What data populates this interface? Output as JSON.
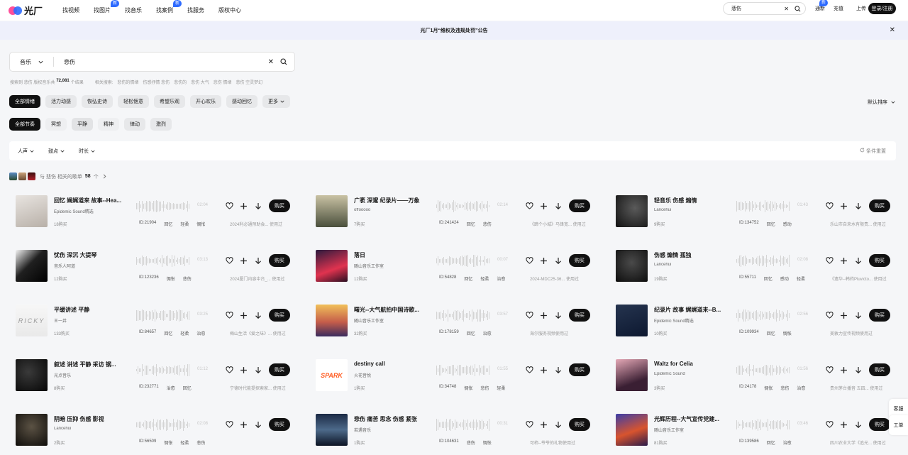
{
  "brand": {
    "name": "光厂"
  },
  "nav": [
    {
      "label": "找视频",
      "badge": ""
    },
    {
      "label": "找图片",
      "badge": "新"
    },
    {
      "label": "找音乐",
      "badge": ""
    },
    {
      "label": "找案例",
      "badge": "新"
    },
    {
      "label": "找服务",
      "badge": ""
    },
    {
      "label": "版权中心",
      "badge": ""
    }
  ],
  "top_search": {
    "value": "悲伤"
  },
  "top_right": {
    "tongxin": "通新",
    "tongxin_badge": "新",
    "recharge": "充值",
    "upload": "上传",
    "login": "登录/注册"
  },
  "notice": {
    "text": "光厂1月“维权及违规处罚”公告"
  },
  "search": {
    "category": "音乐",
    "value": "悲伤"
  },
  "summary": {
    "prefix": "搜索到 悲伤 版权音乐共",
    "count": "72,081",
    "suffix": "个结果",
    "related_label": "相关搜索:",
    "related": [
      "悲伤的情绪",
      "伤感抒情 悲伤",
      "悲伤的",
      "悲伤 大气",
      "悲伤 情绪",
      "悲伤 空灵梦幻"
    ]
  },
  "mood_chips": [
    "全部情绪",
    "活力动感",
    "恢弘史诗",
    "轻松惬意",
    "希望乐观",
    "开心欢乐",
    "感动回忆",
    "更多"
  ],
  "rhythm_chips": [
    "全部节奏",
    "冥想",
    "平静",
    "精神",
    "律动",
    "激烈"
  ],
  "sort_label": "默认排序",
  "filters": {
    "items": [
      "人声",
      "鼓点",
      "时长"
    ],
    "reset": "条件重置"
  },
  "playlists": {
    "prefix": "与 悲伤 相关的歌单",
    "count": "58",
    "suffix": "个"
  },
  "buy_label": "购买",
  "tracks": [
    {
      "title": "回忆 娓娓道来 故事--Hea...",
      "artist": "Epidemic Sound精选",
      "buys": "18购买",
      "duration": "02:04",
      "id": "ID:21904",
      "tags": [
        "回忆",
        "轻柔",
        "惆怅"
      ],
      "use": "2024利必通预助会... 使用过"
    },
    {
      "title": "广袤 深邃 纪录片——万象",
      "artist": "offooooo",
      "buys": "7购买",
      "duration": "02:14",
      "id": "ID:241424",
      "tags": [
        "回忆",
        "悲伤"
      ],
      "use": "《蹄个小城》马锋宽... 使用过"
    },
    {
      "title": "轻音乐 伤感 煽情",
      "artist": "Lancehui",
      "buys": "9购买",
      "duration": "01:43",
      "id": "ID:134752",
      "tags": [
        "回忆",
        "感动"
      ],
      "use": "乐山市自来水有限责... 使用过"
    },
    {
      "title": "忧伤 深沉 大提琴",
      "artist": "音乐人阿道",
      "buys": "12购买",
      "duration": "03:13",
      "id": "ID:123236",
      "tags": [
        "惆怅",
        "悲伤"
      ],
      "use": "2024厦门内容中台_... 使用过"
    },
    {
      "title": "落日",
      "artist": "随山音乐工作室",
      "buys": "12购买",
      "duration": "00:07",
      "id": "ID:54828",
      "tags": [
        "回忆",
        "轻柔",
        "治愈"
      ],
      "use": "2024-MDC25-36... 使用过"
    },
    {
      "title": "伤感 煽情 孤独",
      "artist": "Lancehui",
      "buys": "19购买",
      "duration": "02:08",
      "id": "ID:55711",
      "tags": [
        "回忆",
        "感动",
        "轻柔"
      ],
      "use": "《遗华--韩药Pluvicto... 使用过"
    },
    {
      "title": "平缓讲述 平静",
      "artist": "王一井",
      "buys": "133购买",
      "duration": "03:25",
      "id": "ID:84657",
      "tags": [
        "回忆",
        "轻柔",
        "治愈"
      ],
      "use": "梅山生活《爱之味》... 使用过"
    },
    {
      "title": "曙光--大气航拍中国诗歌...",
      "artist": "随山音乐工作室",
      "buys": "32购买",
      "duration": "03:57",
      "id": "ID:178159",
      "tags": [
        "回忆",
        "治愈"
      ],
      "use": "海尔服务视频使用过"
    },
    {
      "title": "纪录片 故事 娓娓道来--B...",
      "artist": "Epidemic Sound精选",
      "buys": "10购买",
      "duration": "02:56",
      "id": "ID:109934",
      "tags": [
        "回忆",
        "惆怅"
      ],
      "use": "美敦力宣传视频使用过"
    },
    {
      "title": "叙述 讲述 平静 采访 钢...",
      "artist": "光点音乐",
      "buys": "8购买",
      "duration": "01:12",
      "id": "ID:232771",
      "tags": [
        "治愈",
        "回忆"
      ],
      "use": "宁德时代能提探索家... 使用过"
    },
    {
      "title": "destiny call",
      "artist": "火花音悦",
      "buys": "1购买",
      "duration": "01:55",
      "id": "ID:34748",
      "tags": [
        "惆怅",
        "悲伤",
        "轻柔"
      ],
      "use": ""
    },
    {
      "title": "Waltz for Celia",
      "artist": "Epidemic Sound",
      "buys": "3购买",
      "duration": "01:56",
      "id": "ID:24178",
      "tags": [
        "惆怅",
        "悲伤",
        "治愈"
      ],
      "use": "贵州茅台播音 五四... 使用过"
    },
    {
      "title": "阴暗 压抑 伤感 影视",
      "artist": "Lancehui",
      "buys": "2购买",
      "duration": "02:08",
      "id": "ID:56509",
      "tags": [
        "惆怅",
        "轻柔",
        "悲伤"
      ],
      "use": ""
    },
    {
      "title": "悲伤 痛苦 思念 伤感 紧张",
      "artist": "若遇音乐",
      "buys": "1购买",
      "duration": "00:31",
      "id": "ID:104631",
      "tags": [
        "悲伤",
        "惆怅"
      ],
      "use": "可柿--爷爷的礼物使用过"
    },
    {
      "title": "光辉历程--大气宣传党建...",
      "artist": "随山音乐工作室",
      "buys": "81购买",
      "duration": "03:46",
      "id": "ID:139586",
      "tags": [
        "回忆",
        "治愈"
      ],
      "use": "四川农业大学《追光... 使用过"
    }
  ],
  "side_tabs": [
    "客服",
    "工单"
  ]
}
